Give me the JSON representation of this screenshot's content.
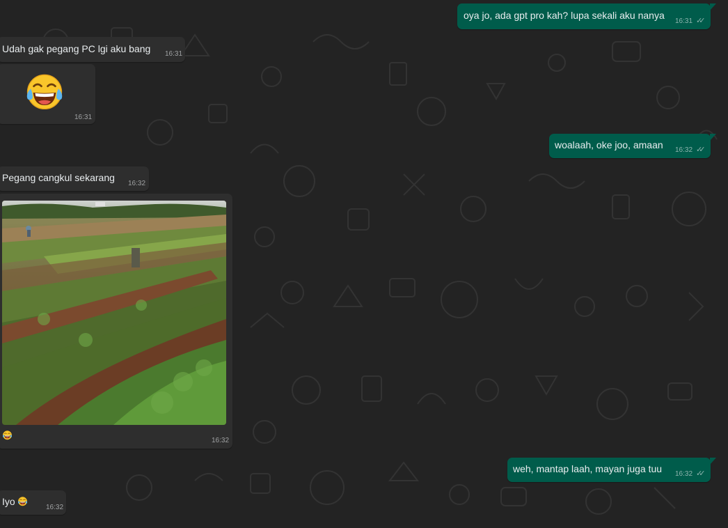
{
  "messages": [
    {
      "direction": "out",
      "text": "oya jo, ada gpt pro kah? lupa sekali aku nanya",
      "time": "16:31",
      "status": "read-double-check"
    },
    {
      "direction": "in",
      "text": "Udah gak pegang PC lgi aku bang",
      "time": "16:31"
    },
    {
      "direction": "in",
      "emoji": "face-with-tears-of-joy",
      "time": "16:31"
    },
    {
      "direction": "out",
      "text": "woalaah, oke joo, amaan",
      "time": "16:32",
      "status": "read-double-check"
    },
    {
      "direction": "in",
      "text": "Pegang cangkul sekarang",
      "time": "16:32"
    },
    {
      "direction": "in",
      "image": "photo-of-farmland-field",
      "caption_emoji": "face-with-tears-of-joy",
      "time": "16:32"
    },
    {
      "direction": "out",
      "text": "weh, mantap laah, mayan juga tuu",
      "time": "16:32",
      "status": "read-double-check"
    },
    {
      "direction": "in",
      "text": "Iyo",
      "trailing_emoji": "face-with-tears-of-joy",
      "time": "16:32"
    }
  ],
  "colors": {
    "background": "#232323",
    "incoming_bubble": "#2e2e2e",
    "outgoing_bubble": "#005c4b",
    "text": "#e9edef"
  }
}
